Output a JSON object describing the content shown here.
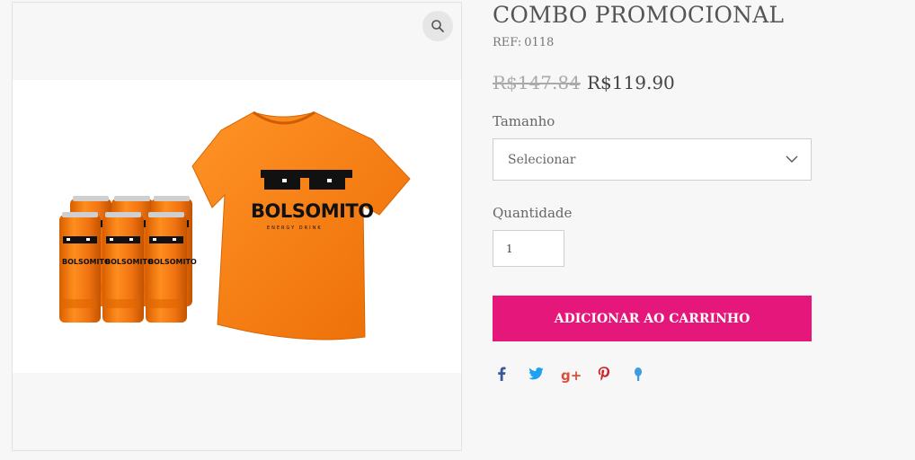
{
  "product": {
    "title": "COMBO PROMOCIONAL",
    "ref_label": "REF:",
    "ref_value": "0118",
    "price_old": "R$147.84",
    "price_new": "R$119.90"
  },
  "image": {
    "brand_text": "BOLSOMITO",
    "sub_text": "ENERGY DRINK",
    "can_text": "BOLSOMITO",
    "product_color": "#f47d12"
  },
  "options": {
    "size_label": "Tamanho",
    "size_selected": "Selecionar",
    "quantity_label": "Quantidade",
    "quantity_value": "1"
  },
  "actions": {
    "add_to_cart": "ADICIONAR AO CARRINHO",
    "button_color": "#e5177b"
  },
  "share": {
    "icons": [
      "facebook-icon",
      "twitter-icon",
      "google-plus-icon",
      "pinterest-icon",
      "tumblr-icon"
    ],
    "colors": {
      "facebook": "#3b5998",
      "twitter": "#1da1f2",
      "google_plus": "#dd4b39",
      "pinterest": "#cb2027",
      "tumblr": "#3b9cdf"
    }
  }
}
